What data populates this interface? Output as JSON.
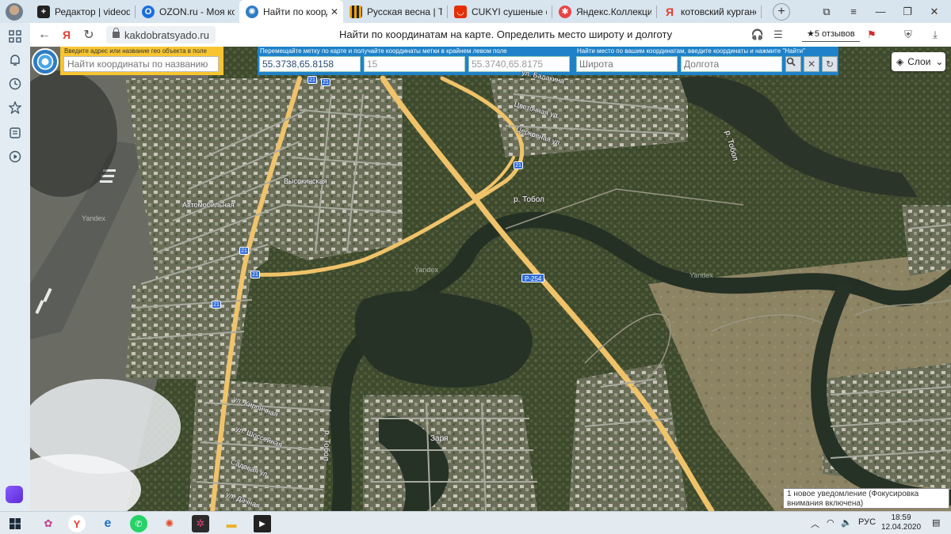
{
  "browser": {
    "tabs": [
      {
        "label": "Редактор | videodoro",
        "icon": "plus-icon",
        "color": "#222222"
      },
      {
        "label": "OZON.ru - Моя корз",
        "icon": "ozon-icon",
        "color": "#1a6fe0"
      },
      {
        "label": "Найти по координ",
        "icon": "compass-icon",
        "color": "#2e7cc4",
        "active": true
      },
      {
        "label": "Русская весна | Толь",
        "icon": "ribbon-icon",
        "color": "#f0a500"
      },
      {
        "label": "CUKYI сушеные фру",
        "icon": "aliexpress-icon",
        "color": "#e62e04"
      },
      {
        "label": "Яндекс.Коллекции",
        "icon": "collections-icon",
        "color": "#e64545"
      },
      {
        "label": "котовский курганска",
        "icon": "yandex-icon",
        "color": "#e63b2e"
      }
    ],
    "close_tab": "✕",
    "new_tab": "+",
    "url": "kakdobratsyado.ru",
    "page_title": "Найти по координатам на карте. Определить место широту и долготу",
    "reviews": "★5 отзывов"
  },
  "map_panel": {
    "search_label": "Введите адрес или название гео объекта в поле",
    "search_placeholder": "Найти координаты по названию",
    "coords_label": "Перемещайте метку по карте и получайте координаты метки в крайнем левом поле",
    "marker_coords": "55.3738,65.8158",
    "zoom": "15",
    "center_coords": "55.3740,65.8175",
    "find_label": "Найти место по вашим координатам, введите координаты и нажмите \"Найти\"",
    "lat_placeholder": "Широта",
    "lon_placeholder": "Долгота",
    "layers": "Слои"
  },
  "map": {
    "labels": {
      "river_tobol_1": "р. Тобол",
      "river_tobol_2": "р. Тобол",
      "river_tobol_3": "р. Тобол",
      "street_vysokinskaya": "Высокинская",
      "street_avtomobilnaya": "Автомобильная",
      "street_balakina": "ул. Балакина",
      "street_tsvetochnaya": "Цветочная ул.",
      "street_tserkovnaya": "Церковная ул.",
      "street_kirpichnaya": "ул. Кирпичная",
      "street_shosseynaya": "ул. Шоссейная",
      "street_sadovaya": "Садовая ул.",
      "street_dachnaya": "ул. Дачная",
      "settlement_zarya": "Заря",
      "route_r254": "Р-254",
      "route_21": "21",
      "watermark": "Yandex"
    }
  },
  "notification": "1 новое уведомление (Фокусировка внимания включена)",
  "taskbar": {
    "lang": "РУС",
    "time": "18:59",
    "date": "12.04.2020"
  }
}
